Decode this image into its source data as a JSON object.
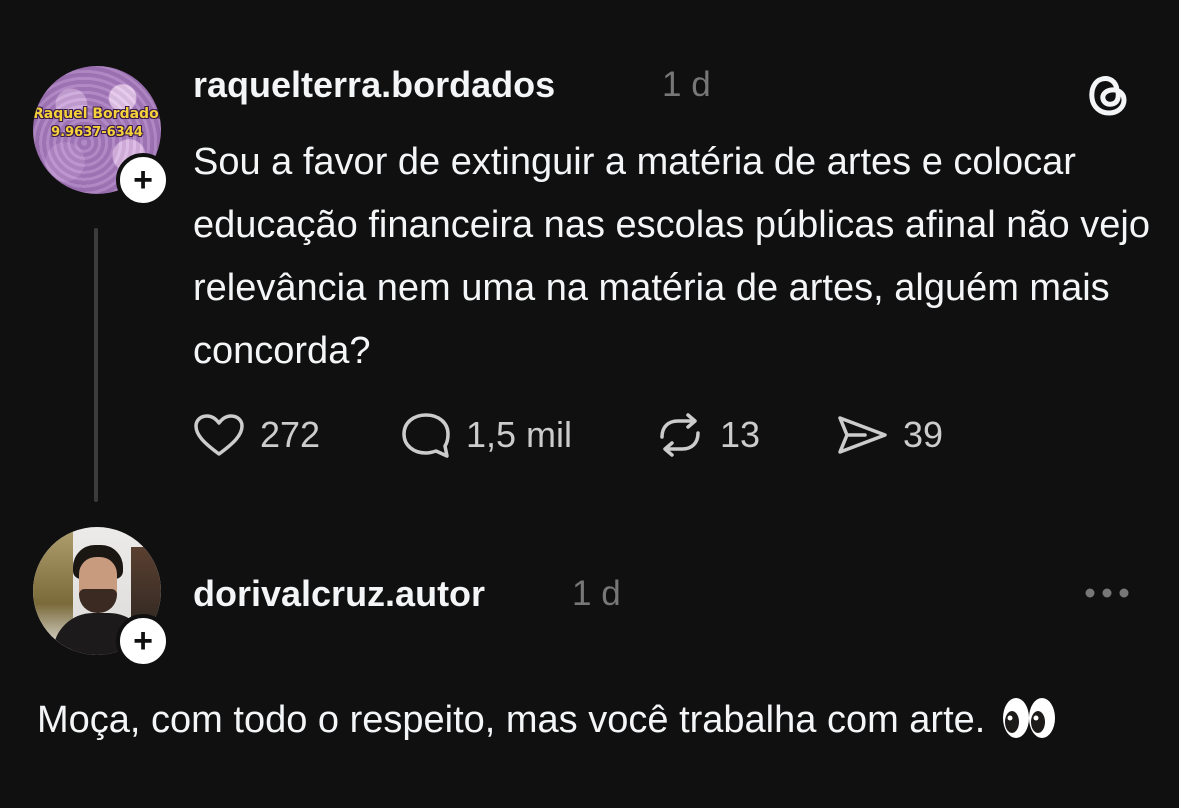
{
  "post": {
    "avatar_text_line1": "Raquel Bordados",
    "avatar_text_line2": "9.9637-6344",
    "username": "raquelterra.bordados",
    "time": "1 d",
    "text": "Sou a favor de extinguir a matéria de artes e colocar educação financeira nas escolas públicas afinal não vejo relevância nem uma na matéria de artes, alguém mais concorda?",
    "actions": {
      "likes": "272",
      "replies": "1,5 mil",
      "reposts": "13",
      "shares": "39"
    },
    "follow_symbol": "+",
    "app_icon": "threads-logo-icon"
  },
  "reply": {
    "username": "dorivalcruz.autor",
    "time": "1 d",
    "text": "Moça, com todo o respeito, mas você trabalha com arte.",
    "emoji": "eyes-emoji-icon",
    "follow_symbol": "+",
    "more_icon": "more-options-icon"
  },
  "colors": {
    "background": "#101010",
    "text_primary": "#f3f5f7",
    "text_secondary": "#777777",
    "action_icon": "#cccccc",
    "thread_line": "#3b3b3b"
  }
}
